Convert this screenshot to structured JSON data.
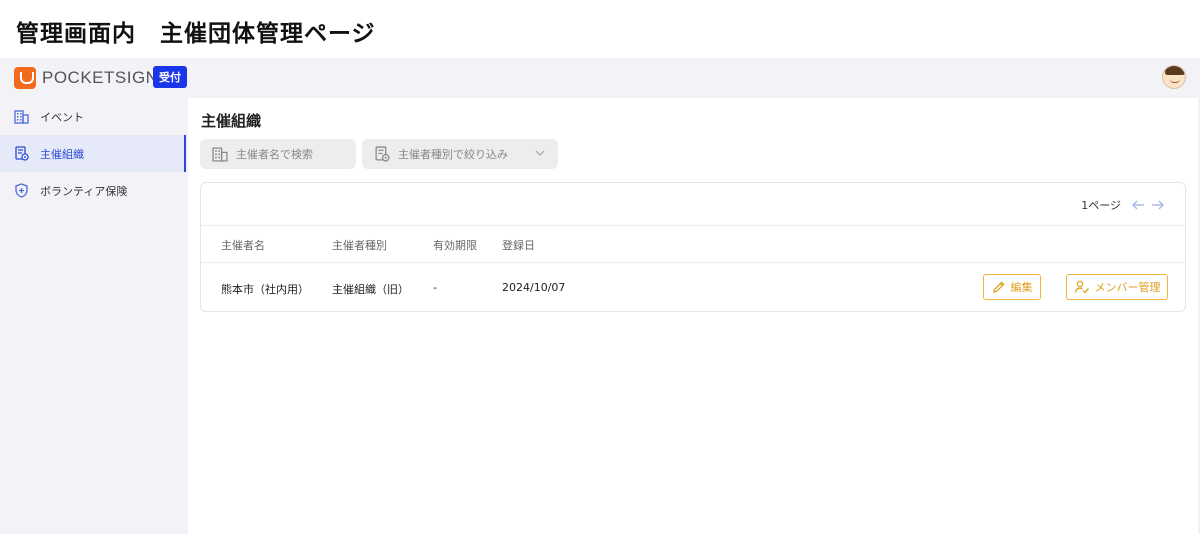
{
  "caption": "管理画面内　主催団体管理ページ",
  "header": {
    "logo_text": "POCKETSIGN",
    "badge": "受付"
  },
  "sidebar": {
    "items": [
      {
        "label": "イベント",
        "icon": "building-icon"
      },
      {
        "label": "主催組織",
        "icon": "document-gear-icon",
        "active": true
      },
      {
        "label": "ボランティア保険",
        "icon": "shield-icon"
      }
    ]
  },
  "main": {
    "title": "主催組織",
    "search": {
      "placeholder": "主催者名で検索",
      "value": ""
    },
    "type_filter": {
      "placeholder": "主催者種別で絞り込み"
    },
    "pager": {
      "label": "1ページ"
    },
    "table": {
      "columns": [
        "主催者名",
        "主催者種別",
        "有効期限",
        "登録日"
      ],
      "rows": [
        {
          "name": "熊本市（社内用）",
          "type": "主催組織（旧）",
          "expiry": "-",
          "registered": "2024/10/07"
        }
      ]
    },
    "actions": {
      "edit_label": "編集",
      "member_label": "メンバー管理"
    }
  },
  "colors": {
    "accent": "#2b4ad9",
    "badge": "#1a36e8",
    "action": "#f3b23c",
    "logo": "#f26b1d"
  }
}
